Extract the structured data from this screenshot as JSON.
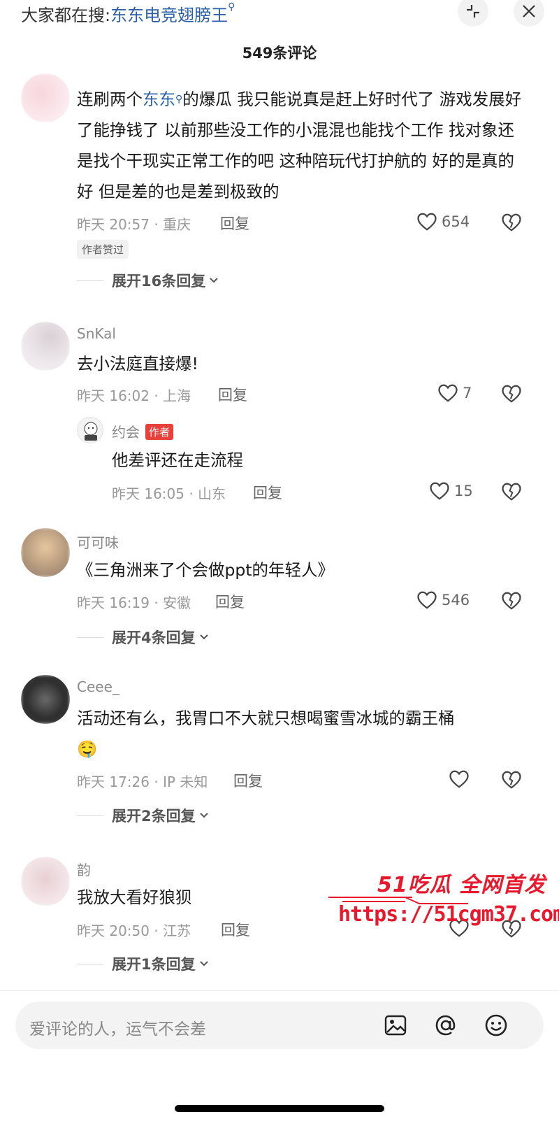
{
  "search_bar": {
    "prefix": "大家都在搜:",
    "keyword": "东东电竞翅膀王"
  },
  "header": {
    "title": "549条评论"
  },
  "comments": [
    {
      "username": "",
      "text_parts": [
        "连刷两个",
        "东东",
        "的爆瓜 我只能说真是赶上好时代了 游戏发展好了能挣钱了 以前那些没工作的小混混也能找个工作 找对象还是找个干现实正常工作的吧 这种陪玩代打护航的 好的是真的好 但是差的也是差到极致的"
      ],
      "meta": "昨天 20:57 · 重庆",
      "reply_label": "回复",
      "likes": "654",
      "pill": "作者赞过",
      "expand": "展开16条回复"
    },
    {
      "username": "SnKal",
      "text": "去小法庭直接爆!",
      "meta": "昨天 16:02 · 上海",
      "reply_label": "回复",
      "likes": "7",
      "sub_reply": {
        "username": "约会",
        "badge": "作者",
        "text": "他差评还在走流程",
        "meta": "昨天 16:05 · 山东",
        "reply_label": "回复",
        "likes": "15"
      }
    },
    {
      "username": "可可味",
      "text": "《三角洲来了个会做ppt的年轻人》",
      "meta": "昨天 16:19 · 安徽",
      "reply_label": "回复",
      "likes": "546",
      "expand": "展开4条回复"
    },
    {
      "username": "Ceee_",
      "text": "活动还有么，我胃口不大就只想喝蜜雪冰城的霸王桶",
      "emoji": "🤤",
      "meta": "昨天 17:26 · IP 未知",
      "reply_label": "回复",
      "likes": "",
      "expand": "展开2条回复"
    },
    {
      "username": "韵",
      "text": "我放大看好狼狈",
      "meta": "昨天 20:50 · 江苏",
      "reply_label": "回复",
      "likes": "",
      "expand": "展开1条回复"
    }
  ],
  "input": {
    "placeholder": "爱评论的人，运气不会差"
  },
  "watermark": {
    "top": "51吃瓜 全网首发",
    "url": "https://51cgm37.com"
  },
  "colors": {
    "link": "#2b5fa8",
    "badge": "#e8413c",
    "watermark": "#e8192c"
  }
}
